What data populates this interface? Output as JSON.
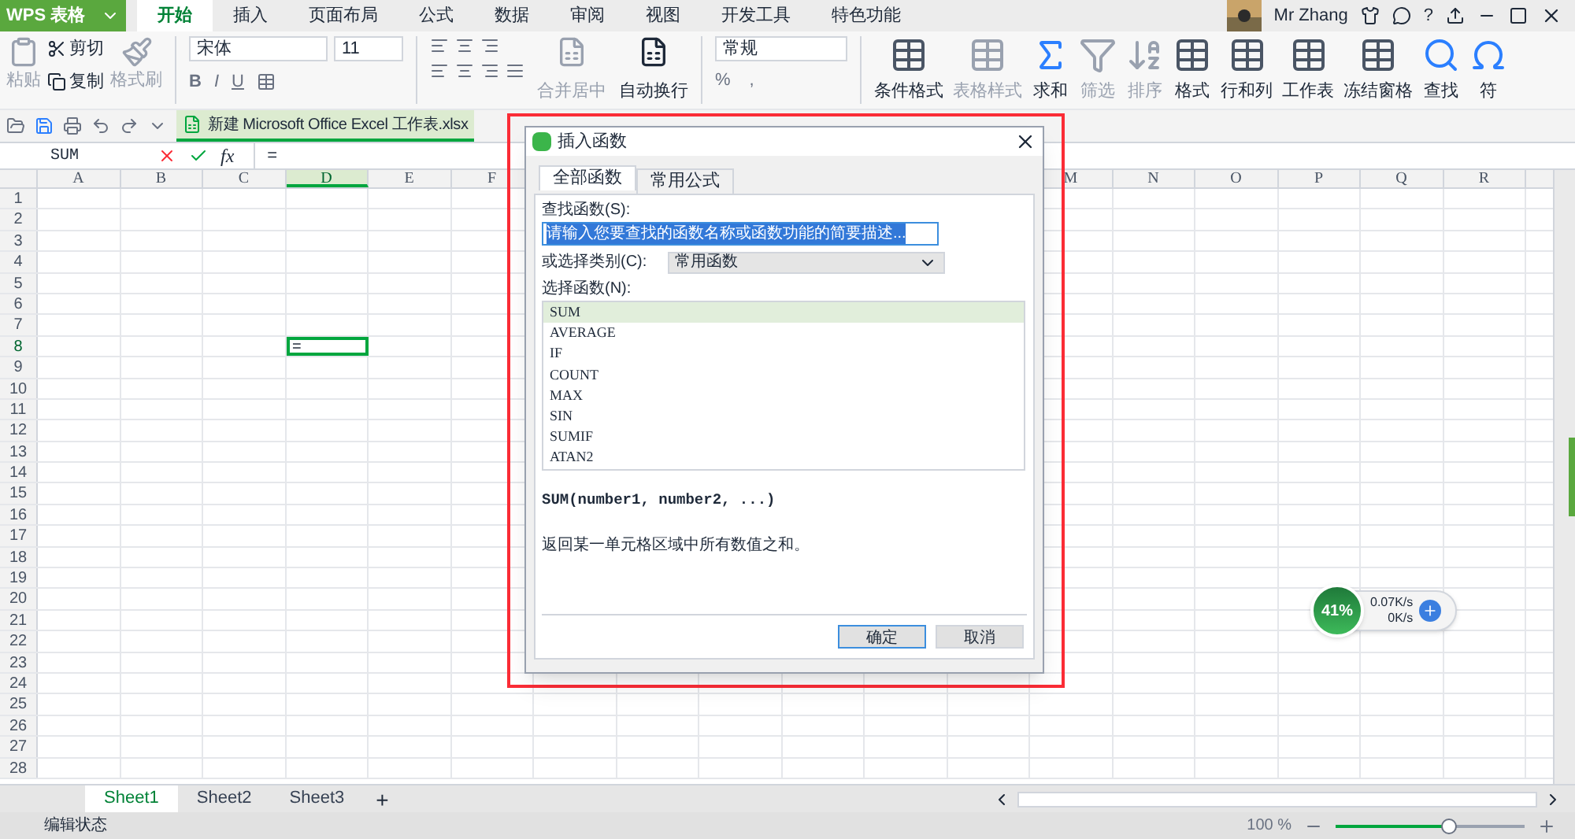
{
  "app": {
    "name": "WPS 表格"
  },
  "menu_tabs": [
    {
      "label": "开始",
      "selected": true
    },
    {
      "label": "插入",
      "selected": false
    },
    {
      "label": "页面布局",
      "selected": false
    },
    {
      "label": "公式",
      "selected": false
    },
    {
      "label": "数据",
      "selected": false
    },
    {
      "label": "审阅",
      "selected": false
    },
    {
      "label": "视图",
      "selected": false
    },
    {
      "label": "开发工具",
      "selected": false
    },
    {
      "label": "特色功能",
      "selected": false
    }
  ],
  "user": {
    "name": "Mr Zhang",
    "help": "?"
  },
  "clipboard": {
    "paste": {
      "label": "粘贴",
      "disabled": true
    },
    "cut": {
      "label": "剪切",
      "disabled": false
    },
    "copy": {
      "label": "复制",
      "disabled": false
    },
    "painter": {
      "label": "格式刷",
      "disabled": true
    }
  },
  "font": {
    "name": "宋体",
    "size": "11",
    "bold": "B",
    "italic": "I",
    "underline": "U"
  },
  "align": [
    {
      "label": "合并居中",
      "disabled": true
    },
    {
      "label": "自动换行",
      "disabled": false
    }
  ],
  "number_format": {
    "value": "常规",
    "percent": "%",
    "comma": ","
  },
  "tools": [
    {
      "label": "条件格式",
      "disabled": false,
      "kind": "grid"
    },
    {
      "label": "表格样式",
      "disabled": true,
      "kind": "grid"
    },
    {
      "label": "求和",
      "disabled": false,
      "kind": "sum"
    },
    {
      "label": "筛选",
      "disabled": true,
      "kind": "filter"
    },
    {
      "label": "排序",
      "disabled": true,
      "kind": "sort"
    },
    {
      "label": "格式",
      "disabled": false,
      "kind": "grid"
    },
    {
      "label": "行和列",
      "disabled": false,
      "kind": "grid"
    },
    {
      "label": "工作表",
      "disabled": false,
      "kind": "grid"
    },
    {
      "label": "冻结窗格",
      "disabled": false,
      "kind": "grid"
    },
    {
      "label": "查找",
      "disabled": false,
      "kind": "find"
    },
    {
      "label": "符",
      "disabled": false,
      "kind": "symbol"
    }
  ],
  "document_tab": {
    "title": "新建 Microsoft Office Excel 工作表.xlsx"
  },
  "formula_bar": {
    "name_box": "SUM",
    "fx": "fx",
    "value": "="
  },
  "columns": [
    {
      "label": "A",
      "selected": false
    },
    {
      "label": "B",
      "selected": false
    },
    {
      "label": "C",
      "selected": false
    },
    {
      "label": "D",
      "selected": true
    },
    {
      "label": "E",
      "selected": false
    },
    {
      "label": "F",
      "selected": false
    },
    {
      "label": "M",
      "selected": false
    },
    {
      "label": "N",
      "selected": false
    },
    {
      "label": "O",
      "selected": false
    },
    {
      "label": "P",
      "selected": false
    },
    {
      "label": "Q",
      "selected": false
    },
    {
      "label": "R",
      "selected": false
    }
  ],
  "rows": [
    "1",
    "2",
    "3",
    "4",
    "5",
    "6",
    "7",
    "8",
    "9",
    "10",
    "11",
    "12",
    "13",
    "14",
    "15",
    "16",
    "17",
    "18",
    "19",
    "20",
    "21",
    "22",
    "23",
    "24",
    "25",
    "26",
    "27",
    "28"
  ],
  "active_cell": {
    "value": "="
  },
  "dialog": {
    "title": "插入函数",
    "tabs": [
      {
        "label": "全部函数",
        "selected": true
      },
      {
        "label": "常用公式",
        "selected": false
      }
    ],
    "search_label": "查找函数(S):",
    "search_value": "请输入您要查找的函数名称或函数功能的简要描述...",
    "category_label": "或选择类别(C):",
    "category_value": "常用函数",
    "list_label": "选择函数(N):",
    "functions": [
      {
        "name": "SUM",
        "selected": true
      },
      {
        "name": "AVERAGE",
        "selected": false
      },
      {
        "name": "IF",
        "selected": false
      },
      {
        "name": "COUNT",
        "selected": false
      },
      {
        "name": "MAX",
        "selected": false
      },
      {
        "name": "SIN",
        "selected": false
      },
      {
        "name": "SUMIF",
        "selected": false
      },
      {
        "name": "ATAN2",
        "selected": false
      }
    ],
    "signature": "SUM(number1, number2, ...)",
    "description": "返回某一单元格区域中所有数值之和。",
    "buttons": [
      "确定",
      "取消"
    ]
  },
  "net_widget": {
    "percent": "41%",
    "up": "0.07K/s",
    "down": "0K/s"
  },
  "sheets": [
    {
      "label": "Sheet1",
      "selected": true
    },
    {
      "label": "Sheet2",
      "selected": false
    },
    {
      "label": "Sheet3",
      "selected": false
    }
  ],
  "add_sheet": "+",
  "status_bar": {
    "mode": "编辑状态",
    "zoom": "100 %",
    "zoom_slider": {
      "level": 0.6
    }
  }
}
